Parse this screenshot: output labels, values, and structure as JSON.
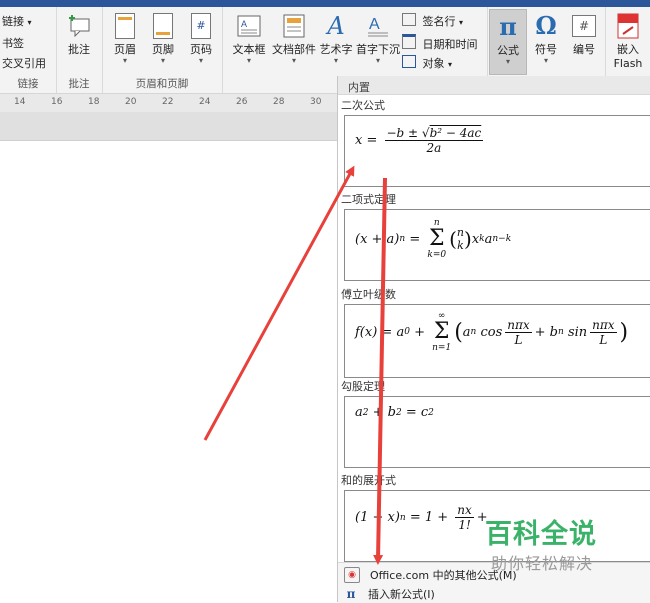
{
  "ribbon": {
    "links_group": {
      "items": [
        "链接",
        "书签",
        "交叉引用"
      ],
      "label": "链接"
    },
    "comment_group": {
      "button": "批注",
      "label": "批注"
    },
    "header_footer_group": {
      "buttons": [
        "页眉",
        "页脚",
        "页码"
      ],
      "label": "页眉和页脚"
    },
    "text_group": {
      "buttons": [
        "文本框",
        "文档部件",
        "艺术字",
        "首字下沉"
      ],
      "small_items": [
        "签名行",
        "日期和时间",
        "对象"
      ]
    },
    "symbols_group": {
      "buttons": [
        "公式",
        "符号",
        "编号"
      ]
    },
    "flash_button": {
      "line1": "嵌入",
      "line2": "Flash"
    }
  },
  "ruler": {
    "ticks": [
      "14",
      "16",
      "18",
      "20",
      "22",
      "24",
      "26",
      "28",
      "30"
    ]
  },
  "gallery": {
    "header": "内置",
    "sections": [
      {
        "title": "二次公式"
      },
      {
        "title": "二项式定理"
      },
      {
        "title": "傅立叶级数"
      },
      {
        "title": "勾股定理"
      },
      {
        "title": "和的展开式"
      }
    ],
    "footer": {
      "more_link": "Office.com 中的其他公式(M)",
      "insert_new": "插入新公式(I)"
    }
  },
  "watermark": {
    "main": "百科全说",
    "sub": "助你轻松解决"
  },
  "colors": {
    "accent": "#2b579a",
    "arrow": "#e8403a",
    "watermark": "#3bb26a"
  }
}
